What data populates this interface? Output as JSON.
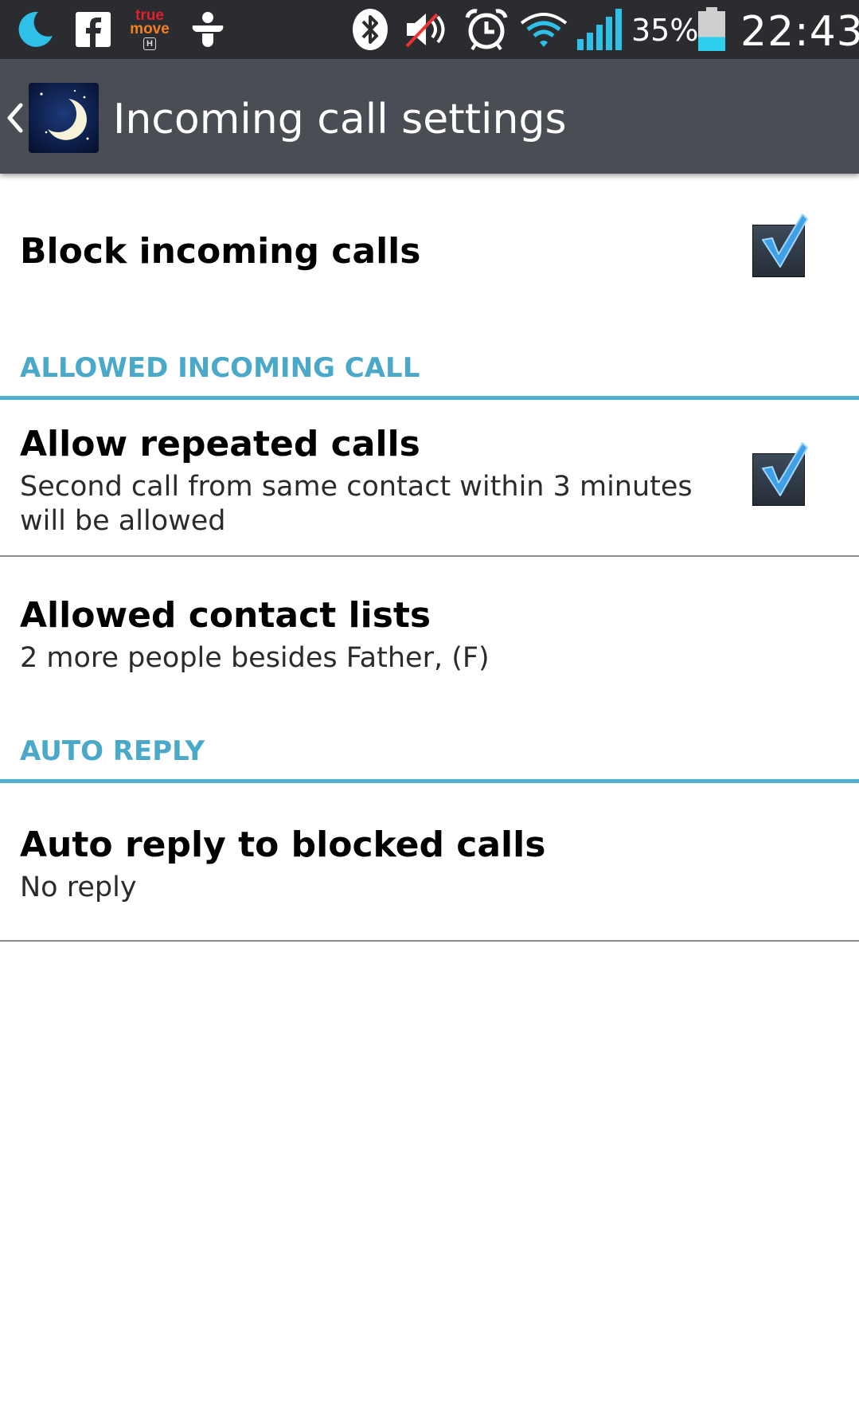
{
  "status_bar": {
    "icons": [
      "moon-app-icon",
      "facebook-icon",
      "truemove-h-icon",
      "tango-icon",
      "bluetooth-icon",
      "volume-muted-icon",
      "alarm-icon",
      "wifi-icon",
      "signal-icon",
      "battery-icon"
    ],
    "carrier_logo": {
      "line1": "true",
      "line2": "move",
      "badge": "H"
    },
    "battery_percent": "35%",
    "battery_level": 0.35,
    "time": "22:43"
  },
  "action_bar": {
    "title": "Incoming call settings",
    "app_icon": "moon-icon"
  },
  "settings": {
    "block_incoming": {
      "title": "Block incoming calls",
      "checked": true
    },
    "section_allowed": {
      "label": "ALLOWED INCOMING CALL"
    },
    "allow_repeated": {
      "title": "Allow repeated calls",
      "summary": "Second call from same contact within 3 minutes will be allowed",
      "checked": true
    },
    "allowed_contacts": {
      "title": "Allowed contact lists",
      "summary": "2 more people besides Father, (F)"
    },
    "section_auto_reply": {
      "label": "AUTO REPLY"
    },
    "auto_reply": {
      "title": "Auto reply to blocked calls",
      "summary": "No reply"
    }
  },
  "colors": {
    "status_bar_bg": "#2a2c30",
    "action_bar_bg": "#4a4d54",
    "section_accent": "#4aa8c9",
    "checkmark": "#3fa0e6"
  }
}
